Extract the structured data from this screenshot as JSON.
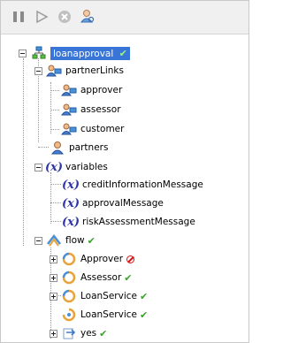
{
  "toolbar": {
    "buttons": [
      {
        "name": "pause-button",
        "icon": "pause-icon"
      },
      {
        "name": "play-button",
        "icon": "play-icon"
      },
      {
        "name": "stop-button",
        "icon": "stop-icon"
      },
      {
        "name": "user-search-button",
        "icon": "user-search-icon"
      }
    ]
  },
  "tree": {
    "root": {
      "label": "loanapproval",
      "status": "✔"
    },
    "partnerLinks": {
      "label": "partnerLinks",
      "items": [
        "approver",
        "assessor",
        "customer"
      ]
    },
    "partners": {
      "label": "partners"
    },
    "variables": {
      "label": "variables",
      "icon_text": "(x)",
      "items": [
        "creditInformationMessage",
        "approvalMessage",
        "riskAssessmentMessage"
      ]
    },
    "flow": {
      "label": "flow",
      "status": "✔",
      "items": [
        {
          "label": "Approver",
          "status": "error"
        },
        {
          "label": "Assessor",
          "status": "✔"
        },
        {
          "label": "LoanService",
          "status": "✔"
        },
        {
          "label": "LoanService",
          "status": "✔"
        },
        {
          "label": "yes",
          "status": "✔"
        }
      ]
    }
  },
  "colors": {
    "selection": "#3875d7",
    "check": "#3aa12a",
    "error": "#dd1111",
    "variable": "#2c34a8"
  }
}
